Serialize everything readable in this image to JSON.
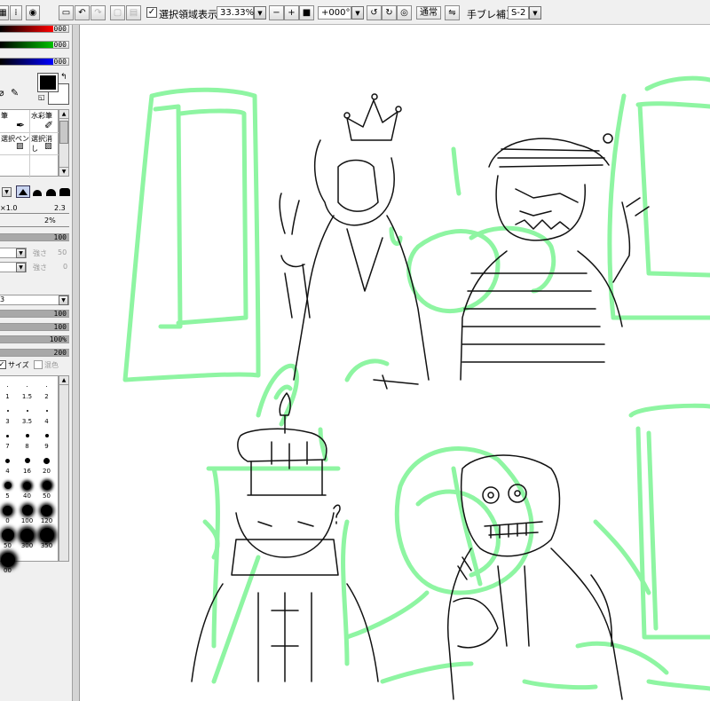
{
  "toolbar": {
    "selection_label": "選択領域表示",
    "selection_checked": true,
    "zoom_value": "33.33%",
    "rotation_value": "+000°",
    "blend_mode": "通常",
    "stabilizer_label": "手ブレ補正",
    "stabilizer_value": "S-2"
  },
  "color": {
    "red_value": "000",
    "green_value": "000",
    "blue_value": "000",
    "foreground": "#000000",
    "background": "#ffffff"
  },
  "tools": {
    "pen_label": "筆",
    "watercolor_label": "水彩筆",
    "select_pen_label": "選択ペン",
    "select_erase_label": "選択消し"
  },
  "brush": {
    "density_label": "×1.0",
    "max_size_value": "2.3",
    "min_size_value": "2%",
    "density_value": "100",
    "strength1_label": "強さ",
    "strength1_value": "50",
    "strength2_label": "強さ",
    "strength2_value": "0",
    "texture_value": "3",
    "blend_value": "100",
    "dilution_value": "100",
    "persistence_value": "100%",
    "blur_value": "200",
    "size_check_label": "サイズ",
    "mix_check_label": "混色"
  },
  "brush_sizes": [
    {
      "label": "1",
      "d": 1
    },
    {
      "label": "1.5",
      "d": 1
    },
    {
      "label": "2",
      "d": 1
    },
    {
      "label": "3",
      "d": 2
    },
    {
      "label": "3.5",
      "d": 2
    },
    {
      "label": "4",
      "d": 2
    },
    {
      "label": "7",
      "d": 3
    },
    {
      "label": "8",
      "d": 4
    },
    {
      "label": "9",
      "d": 4
    },
    {
      "label": "4",
      "d": 5
    },
    {
      "label": "16",
      "d": 6
    },
    {
      "label": "20",
      "d": 7
    },
    {
      "label": "5",
      "d": 8
    },
    {
      "label": "40",
      "d": 9
    },
    {
      "label": "50",
      "d": 10
    },
    {
      "label": "0",
      "d": 11
    },
    {
      "label": "100",
      "d": 12
    },
    {
      "label": "120",
      "d": 13
    },
    {
      "label": "50",
      "d": 14
    },
    {
      "label": "300",
      "d": 15
    },
    {
      "label": "350",
      "d": 16
    },
    {
      "label": "00",
      "d": 16
    }
  ],
  "canvas": {
    "sketch_color": "#8ef5a2",
    "ink_color": "#111111"
  }
}
